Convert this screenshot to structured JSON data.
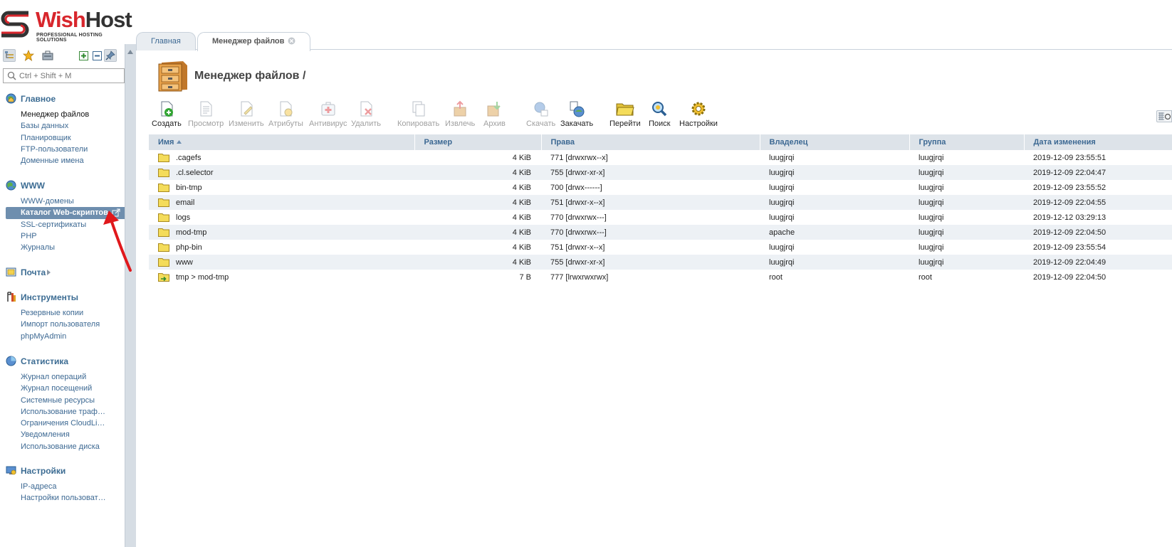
{
  "brand": {
    "name_a": "Wish",
    "name_b": "Host",
    "tagline": "PROFESSIONAL HOSTING SOLUTIONS",
    "color_red": "#d8262c"
  },
  "sidebar": {
    "search_placeholder": "Ctrl + Shift + M",
    "toolbar_icons": [
      "tree-icon",
      "star-icon",
      "toolbox-icon",
      "expand-icon",
      "collapse-icon",
      "pin-icon"
    ],
    "sections": [
      {
        "label": "Главное",
        "icon": "globe-home-icon",
        "items": [
          "Менеджер файлов",
          "Базы данных",
          "Планировщик",
          "FTP-пользователи",
          "Доменные имена"
        ]
      },
      {
        "label": "WWW",
        "icon": "www-globe-icon",
        "items": [
          "WWW-домены",
          "Каталог Web-скриптов",
          "SSL-сертификаты",
          "PHP",
          "Журналы"
        ]
      },
      {
        "label": "Почта",
        "icon": "mail-icon",
        "items": []
      },
      {
        "label": "Инструменты",
        "icon": "tools-icon",
        "items": [
          "Резервные копии",
          "Импорт пользователя",
          "phpMyAdmin"
        ]
      },
      {
        "label": "Статистика",
        "icon": "stats-pie-icon",
        "items": [
          "Журнал операций",
          "Журнал посещений",
          "Системные ресурсы",
          "Использование траф…",
          "Ограничения CloudLi…",
          "Уведомления",
          "Использование диска"
        ]
      },
      {
        "label": "Настройки",
        "icon": "settings-monitor-icon",
        "items": [
          "IP-адреса",
          "Настройки пользоват…"
        ]
      }
    ]
  },
  "tabs": [
    {
      "label": "Главная"
    },
    {
      "label": "Менеджер файлов"
    }
  ],
  "page": {
    "title": "Менеджер файлов /"
  },
  "toolbar": [
    {
      "label": "Создать",
      "icon": "create-icon",
      "enabled": true
    },
    {
      "label": "Просмотр",
      "icon": "view-icon",
      "enabled": false
    },
    {
      "label": "Изменить",
      "icon": "edit-icon",
      "enabled": false
    },
    {
      "label": "Атрибуты",
      "icon": "attributes-icon",
      "enabled": false
    },
    {
      "label": "Антивирус",
      "icon": "antivirus-icon",
      "enabled": false
    },
    {
      "label": "Удалить",
      "icon": "delete-icon",
      "enabled": false
    },
    {
      "label": "Копировать",
      "icon": "copy-icon",
      "enabled": false
    },
    {
      "label": "Извлечь",
      "icon": "extract-icon",
      "enabled": false
    },
    {
      "label": "Архив",
      "icon": "archive-icon",
      "enabled": false
    },
    {
      "label": "Скачать",
      "icon": "download-icon",
      "enabled": false
    },
    {
      "label": "Закачать",
      "icon": "upload-icon",
      "enabled": true
    },
    {
      "label": "Перейти",
      "icon": "goto-folder-icon",
      "enabled": true
    },
    {
      "label": "Поиск",
      "icon": "search-magnifier-icon",
      "enabled": true
    },
    {
      "label": "Настройки",
      "icon": "settings-gear-icon",
      "enabled": true
    }
  ],
  "table": {
    "columns": [
      "Имя",
      "Размер",
      "Права",
      "Владелец",
      "Группа",
      "Дата изменения"
    ],
    "rows": [
      {
        "name": ".cagefs",
        "size": "4 KiB",
        "perms": "771 [drwxrwx--x]",
        "owner": "luugjrqi",
        "group": "luugjrqi",
        "date": "2019-12-09 23:55:51",
        "type": "folder"
      },
      {
        "name": ".cl.selector",
        "size": "4 KiB",
        "perms": "755 [drwxr-xr-x]",
        "owner": "luugjrqi",
        "group": "luugjrqi",
        "date": "2019-12-09 22:04:47",
        "type": "folder"
      },
      {
        "name": "bin-tmp",
        "size": "4 KiB",
        "perms": "700 [drwx------]",
        "owner": "luugjrqi",
        "group": "luugjrqi",
        "date": "2019-12-09 23:55:52",
        "type": "folder"
      },
      {
        "name": "email",
        "size": "4 KiB",
        "perms": "751 [drwxr-x--x]",
        "owner": "luugjrqi",
        "group": "luugjrqi",
        "date": "2019-12-09 22:04:55",
        "type": "folder"
      },
      {
        "name": "logs",
        "size": "4 KiB",
        "perms": "770 [drwxrwx---]",
        "owner": "luugjrqi",
        "group": "luugjrqi",
        "date": "2019-12-12 03:29:13",
        "type": "folder"
      },
      {
        "name": "mod-tmp",
        "size": "4 KiB",
        "perms": "770 [drwxrwx---]",
        "owner": "apache",
        "group": "luugjrqi",
        "date": "2019-12-09 22:04:50",
        "type": "folder"
      },
      {
        "name": "php-bin",
        "size": "4 KiB",
        "perms": "751 [drwxr-x--x]",
        "owner": "luugjrqi",
        "group": "luugjrqi",
        "date": "2019-12-09 23:55:54",
        "type": "folder"
      },
      {
        "name": "www",
        "size": "4 KiB",
        "perms": "755 [drwxr-xr-x]",
        "owner": "luugjrqi",
        "group": "luugjrqi",
        "date": "2019-12-09 22:04:49",
        "type": "folder"
      },
      {
        "name": "tmp > mod-tmp",
        "size": "7 B",
        "perms": "777 [lrwxrwxrwx]",
        "owner": "root",
        "group": "root",
        "date": "2019-12-09 22:04:50",
        "type": "symlink"
      }
    ]
  }
}
